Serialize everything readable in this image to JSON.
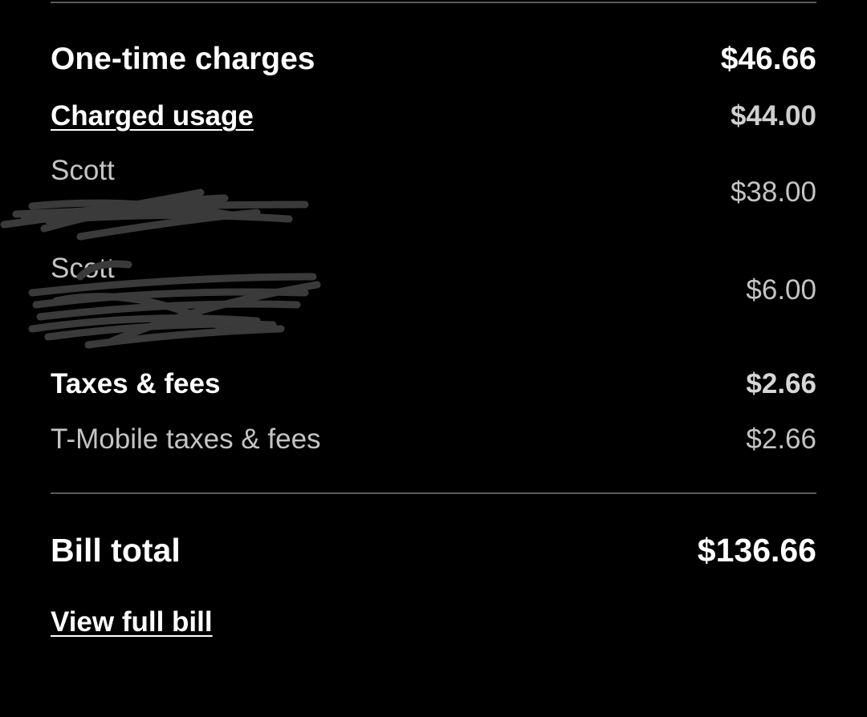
{
  "one_time_charges": {
    "title": "One-time charges",
    "amount": "$46.66"
  },
  "charged_usage": {
    "label": "Charged usage",
    "amount": "$44.00",
    "lines": [
      {
        "name": "Scott",
        "amount": "$38.00"
      },
      {
        "name": "Scott",
        "amount": "$6.00"
      }
    ]
  },
  "taxes_fees": {
    "label": "Taxes & fees",
    "amount": "$2.66",
    "lines": [
      {
        "name": "T-Mobile taxes & fees",
        "amount": "$2.66"
      }
    ]
  },
  "bill_total": {
    "label": "Bill total",
    "amount": "$136.66"
  },
  "view_full_bill": {
    "label": "View full bill"
  },
  "colors": {
    "background": "#000000",
    "primary_text": "#ffffff",
    "secondary_text": "#c4c4c4",
    "divider": "#5a5a5a",
    "redaction_scribble": "#3a3a3a"
  }
}
